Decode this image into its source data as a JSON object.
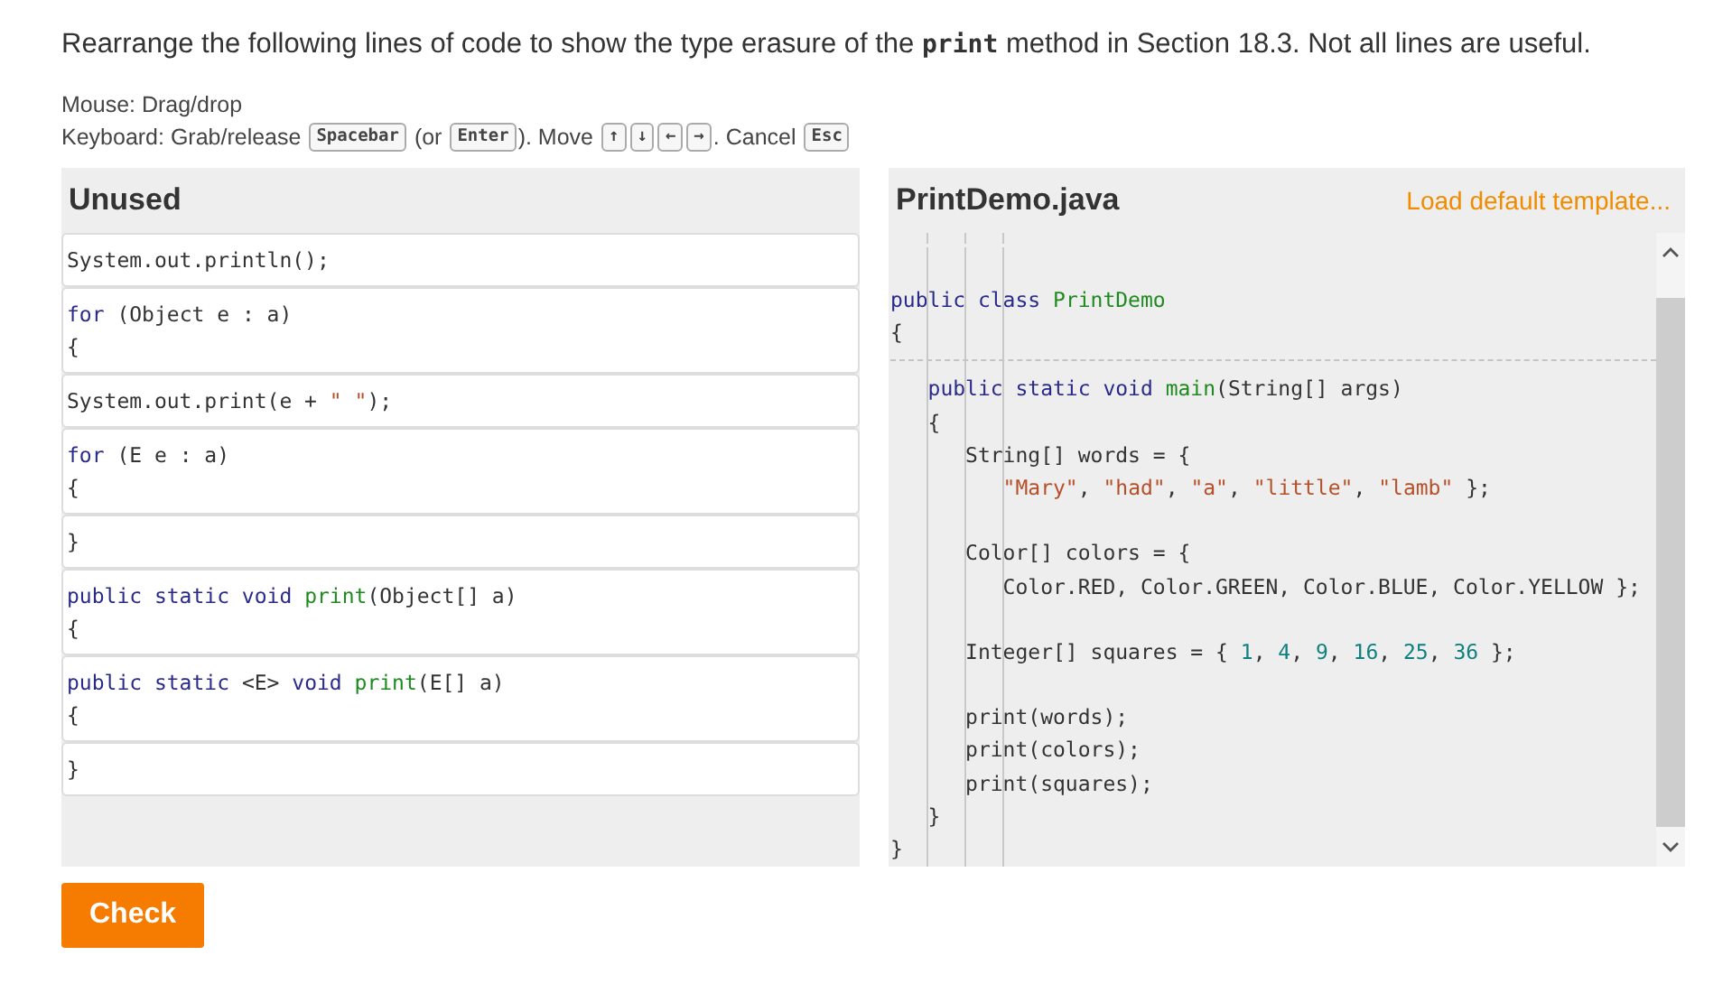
{
  "instruction": [
    {
      "text": "Rearrange the following lines of code to show the type erasure of the ",
      "kind": "plain"
    },
    {
      "text": "print",
      "kind": "code"
    },
    {
      "text": " method in Section 18.3. Not all lines are useful.",
      "kind": "plain"
    }
  ],
  "help": [
    [
      {
        "text": "Mouse: Drag/drop",
        "kind": "plain"
      }
    ],
    [
      {
        "text": "Keyboard: Grab/release ",
        "kind": "plain"
      },
      {
        "text": "Spacebar",
        "kind": "key"
      },
      {
        "text": " (or ",
        "kind": "plain"
      },
      {
        "text": "Enter",
        "kind": "key"
      },
      {
        "text": "). Move ",
        "kind": "plain"
      },
      {
        "text": "↑",
        "kind": "key"
      },
      {
        "text": "↓",
        "kind": "key"
      },
      {
        "text": "←",
        "kind": "key"
      },
      {
        "text": "→",
        "kind": "key"
      },
      {
        "text": ". Cancel ",
        "kind": "plain"
      },
      {
        "text": "Esc",
        "kind": "key"
      }
    ]
  ],
  "unused": {
    "title": "Unused",
    "tiles": [
      [
        [
          {
            "text": "System.out.println();",
            "kind": "plain"
          }
        ]
      ],
      [
        [
          {
            "text": "for",
            "kind": "keyword"
          },
          {
            "text": " (Object e : a)",
            "kind": "plain"
          }
        ],
        [
          {
            "text": "{",
            "kind": "plain"
          }
        ]
      ],
      [
        [
          {
            "text": "System.out.print(e + ",
            "kind": "plain"
          },
          {
            "text": "\" \"",
            "kind": "string"
          },
          {
            "text": ");",
            "kind": "plain"
          }
        ]
      ],
      [
        [
          {
            "text": "for",
            "kind": "keyword"
          },
          {
            "text": " (E e : a)",
            "kind": "plain"
          }
        ],
        [
          {
            "text": "{",
            "kind": "plain"
          }
        ]
      ],
      [
        [
          {
            "text": "}",
            "kind": "plain"
          }
        ]
      ],
      [
        [
          {
            "text": "public static void ",
            "kind": "keyword"
          },
          {
            "text": "print",
            "kind": "name"
          },
          {
            "text": "(Object[] a)",
            "kind": "plain"
          }
        ],
        [
          {
            "text": "{",
            "kind": "plain"
          }
        ]
      ],
      [
        [
          {
            "text": "public static ",
            "kind": "keyword"
          },
          {
            "text": "<E>",
            "kind": "plain"
          },
          {
            "text": " void ",
            "kind": "keyword"
          },
          {
            "text": "print",
            "kind": "name"
          },
          {
            "text": "(E[] a)",
            "kind": "plain"
          }
        ],
        [
          {
            "text": "{",
            "kind": "plain"
          }
        ]
      ],
      [
        [
          {
            "text": "}",
            "kind": "plain"
          }
        ]
      ]
    ]
  },
  "editor": {
    "title": "PrintDemo.java",
    "template_link": "Load default template...",
    "header_lines": [
      [
        {
          "text": "public class ",
          "kind": "keyword"
        },
        {
          "text": "PrintDemo",
          "kind": "name"
        }
      ],
      [
        {
          "text": "{",
          "kind": "plain"
        }
      ]
    ],
    "region_lines": [
      {
        "gap_before": false,
        "segments": [
          {
            "text": "   public static void ",
            "kind": "keyword"
          },
          {
            "text": "main",
            "kind": "name"
          },
          {
            "text": "(String[] args)",
            "kind": "plain"
          }
        ]
      },
      {
        "gap_before": false,
        "segments": [
          {
            "text": "   {",
            "kind": "plain"
          }
        ]
      },
      {
        "gap_before": false,
        "segments": [
          {
            "text": "      String[] words = {",
            "kind": "plain"
          }
        ]
      },
      {
        "gap_before": false,
        "segments": [
          {
            "text": "         \"Mary\"",
            "kind": "string"
          },
          {
            "text": ", ",
            "kind": "plain"
          },
          {
            "text": "\"had\"",
            "kind": "string"
          },
          {
            "text": ", ",
            "kind": "plain"
          },
          {
            "text": "\"a\"",
            "kind": "string"
          },
          {
            "text": ", ",
            "kind": "plain"
          },
          {
            "text": "\"little\"",
            "kind": "string"
          },
          {
            "text": ", ",
            "kind": "plain"
          },
          {
            "text": "\"lamb\"",
            "kind": "string"
          },
          {
            "text": " };",
            "kind": "plain"
          }
        ]
      },
      {
        "gap_before": true,
        "segments": [
          {
            "text": "      Color[] colors = {",
            "kind": "plain"
          }
        ]
      },
      {
        "gap_before": false,
        "segments": [
          {
            "text": "         Color.RED, Color.GREEN, Color.BLUE, Color.YELLOW };",
            "kind": "plain"
          }
        ]
      },
      {
        "gap_before": true,
        "segments": [
          {
            "text": "      Integer[] squares = { ",
            "kind": "plain"
          },
          {
            "text": "1",
            "kind": "number"
          },
          {
            "text": ", ",
            "kind": "plain"
          },
          {
            "text": "4",
            "kind": "number"
          },
          {
            "text": ", ",
            "kind": "plain"
          },
          {
            "text": "9",
            "kind": "number"
          },
          {
            "text": ", ",
            "kind": "plain"
          },
          {
            "text": "16",
            "kind": "number"
          },
          {
            "text": ", ",
            "kind": "plain"
          },
          {
            "text": "25",
            "kind": "number"
          },
          {
            "text": ", ",
            "kind": "plain"
          },
          {
            "text": "36",
            "kind": "number"
          },
          {
            "text": " };",
            "kind": "plain"
          }
        ]
      },
      {
        "gap_before": true,
        "segments": [
          {
            "text": "      print(words);",
            "kind": "plain"
          }
        ]
      },
      {
        "gap_before": false,
        "segments": [
          {
            "text": "      print(colors);",
            "kind": "plain"
          }
        ]
      },
      {
        "gap_before": false,
        "segments": [
          {
            "text": "      print(squares);",
            "kind": "plain"
          }
        ]
      },
      {
        "gap_before": false,
        "segments": [
          {
            "text": "   }",
            "kind": "plain"
          }
        ]
      },
      {
        "gap_before": false,
        "segments": [
          {
            "text": "}",
            "kind": "plain"
          }
        ]
      }
    ]
  },
  "check_button": "Check"
}
